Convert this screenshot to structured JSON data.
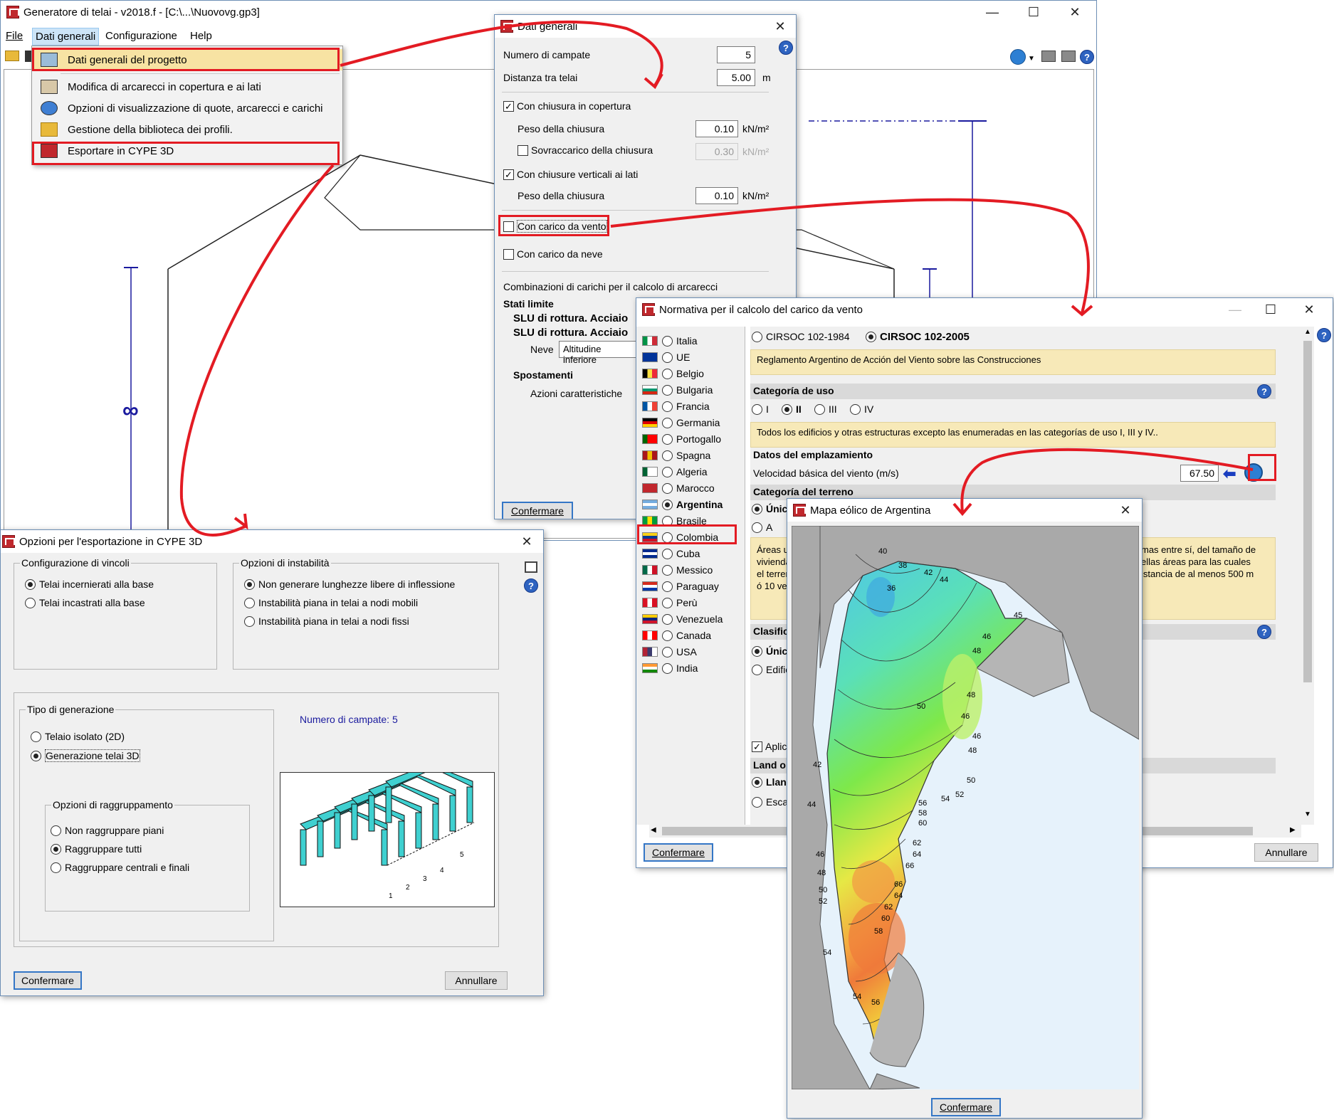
{
  "main": {
    "title": "Generatore di telai - v2018.f - [C:\\...\\Nuovovg.gp3]",
    "menu": [
      "File",
      "Dati generali",
      "Configurazione",
      "Help"
    ],
    "dropdown": [
      "Dati generali del progetto",
      "Modifica di arcarecci in copertura e ai lati",
      "Opzioni di visualizzazione di quote, arcarecci e carichi",
      "Gestione della biblioteca dei profili.",
      "Esportare in CYPE 3D"
    ],
    "infinity": "∞"
  },
  "dati": {
    "title": "Dati generali",
    "n_campate_label": "Numero di campate",
    "n_campate": "5",
    "distanza_label": "Distanza tra telai",
    "distanza": "5.00",
    "unit_m": "m",
    "chiusura_copertura": "Con chiusura in copertura",
    "peso_chiusura": "Peso della chiusura",
    "peso1": "0.10",
    "unit_kn": "kN/m²",
    "sovraccarico": "Sovraccarico della chiusura",
    "sovra_val": "0.30",
    "chiusure_lati": "Con chiusure verticali ai lati",
    "peso2": "0.10",
    "vento": "Con carico da vento",
    "neve": "Con carico da neve",
    "combinazioni": "Combinazioni di carichi per il calcolo di arcarecci",
    "stati_limite": "Stati limite",
    "slu1": "SLU di rottura. Acciaio",
    "slu2": "SLU di rottura. Acciaio",
    "neve_label": "Neve",
    "neve_value": "Altitudine inferiore",
    "spostamenti": "Spostamenti",
    "azioni": "Azioni caratteristiche",
    "confermare": "Confermare"
  },
  "export": {
    "title": "Opzioni per l'esportazione in CYPE 3D",
    "vincoli_title": "Configurazione di vincoli",
    "vincoli": [
      "Telai incernierati alla base",
      "Telai incastrati alla base"
    ],
    "instab_title": "Opzioni di instabilità",
    "instab": [
      "Non generare lunghezze libere di inflessione",
      "Instabilità piana in telai a nodi mobili",
      "Instabilità piana in telai a nodi fissi"
    ],
    "tipo_title": "Tipo di generazione",
    "tipo": [
      "Telaio isolato (2D)",
      "Generazione telai 3D"
    ],
    "numero": "Numero di campate: 5",
    "ragg_title": "Opzioni di raggruppamento",
    "ragg": [
      "Non raggruppare piani",
      "Raggruppare tutti",
      "Raggruppare centrali e finali"
    ],
    "preview_labels": [
      "1",
      "2",
      "3",
      "4",
      "5"
    ],
    "confermare": "Confermare",
    "annullare": "Annullare"
  },
  "normativa": {
    "title": "Normativa per il calcolo del carico da vento",
    "countries": [
      "Italia",
      "UE",
      "Belgio",
      "Bulgaria",
      "Francia",
      "Germania",
      "Portogallo",
      "Spagna",
      "Algeria",
      "Marocco",
      "Argentina",
      "Brasile",
      "Colombia",
      "Cuba",
      "Messico",
      "Paraguay",
      "Perù",
      "Venezuela",
      "Canada",
      "USA",
      "India"
    ],
    "selected_country": "Argentina",
    "norm1": "CIRSOC 102-1984",
    "norm2": "CIRSOC 102-2005",
    "reglamento": "Reglamento Argentino de Acción del Viento sobre las Construcciones",
    "categoria_uso": "Categoría de uso",
    "usos": [
      "I",
      "II",
      "III",
      "IV"
    ],
    "uso_note": "Todos los edificios y otras estructuras excepto las enumeradas en las categorías de uso I, III y IV..",
    "datos": "Datos del emplazamiento",
    "velocidad": "Velocidad básica del viento (m/s)",
    "velocidad_val": "67.50",
    "categoria_terreno": "Categoría del terreno",
    "unica": "Únic",
    "a": "A",
    "areas_note_left": "Áreas u\nvivienda\nel terren\nó 10 ve",
    "areas_note_right": "mas entre sí, del tamaño de\nellas áreas para las cuales\nistancia de al menos 500 m",
    "clasific": "Clasific",
    "unic2": "Únic",
    "edific": "Edific",
    "aplica": "Aplic",
    "land": "Land o",
    "llan": "Llan",
    "esca": "Esca",
    "confermare": "Confermare",
    "annullare": "Annullare"
  },
  "mapa": {
    "title": "Mapa eólico de Argentina",
    "isolines": [
      "40",
      "38",
      "36",
      "42",
      "44",
      "45",
      "46",
      "48",
      "48",
      "46",
      "50",
      "46",
      "48",
      "50",
      "52",
      "54",
      "56",
      "58",
      "60",
      "62",
      "64",
      "66",
      "66",
      "64",
      "62",
      "60",
      "58",
      "56",
      "54",
      "42",
      "44",
      "46",
      "48",
      "50",
      "52",
      "54"
    ],
    "confermare": "Confermare"
  },
  "colors": {
    "highlight_red": "#e31b23",
    "map_cold": "#4fc6e8",
    "map_mid": "#7ee84a",
    "map_hot": "#ef7a3a",
    "land_gray": "#a9a9a9",
    "sea": "#e6f2fb"
  }
}
